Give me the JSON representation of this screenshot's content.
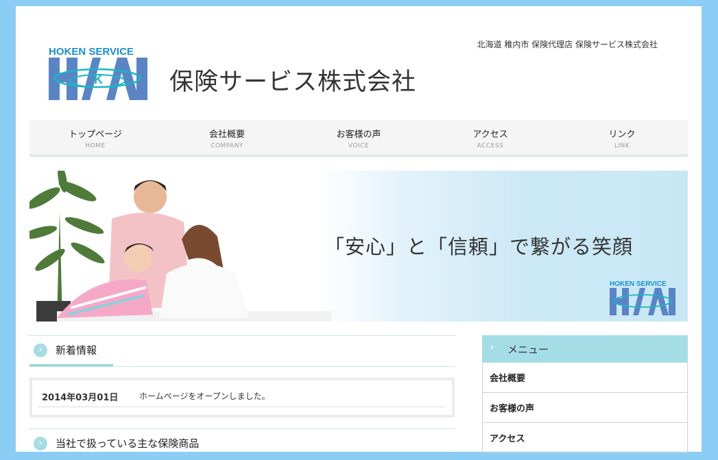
{
  "header": {
    "logo_text": "HOKEN SERVICE",
    "company_name": "保険サービス株式会社",
    "tagline": "北海道 稚内市 保険代理店 保険サービス株式会社"
  },
  "nav": {
    "items": [
      {
        "jp": "トップページ",
        "en": "HOME"
      },
      {
        "jp": "会社概要",
        "en": "COMPANY"
      },
      {
        "jp": "お客様の声",
        "en": "VOICE"
      },
      {
        "jp": "アクセス",
        "en": "ACCESS"
      },
      {
        "jp": "リンク",
        "en": "LINK"
      }
    ]
  },
  "hero": {
    "slogan": "「安心」と「信頼」で繋がる笑顔",
    "logo_text": "HOKEN SERVICE"
  },
  "news": {
    "title": "新着情報",
    "items": [
      {
        "date": "2014年03月01日",
        "text": "ホームページをオープンしました。"
      }
    ]
  },
  "products": {
    "title": "当社で扱っている主な保険商品"
  },
  "sidebar": {
    "menu_title": "メニュー",
    "items": [
      "会社概要",
      "お客様の声",
      "アクセス"
    ]
  },
  "colors": {
    "page_bg": "#8ccdf5",
    "accent": "#a5dde6",
    "logo_blue": "#5b84c4",
    "logo_cyan": "#17b7c6"
  }
}
